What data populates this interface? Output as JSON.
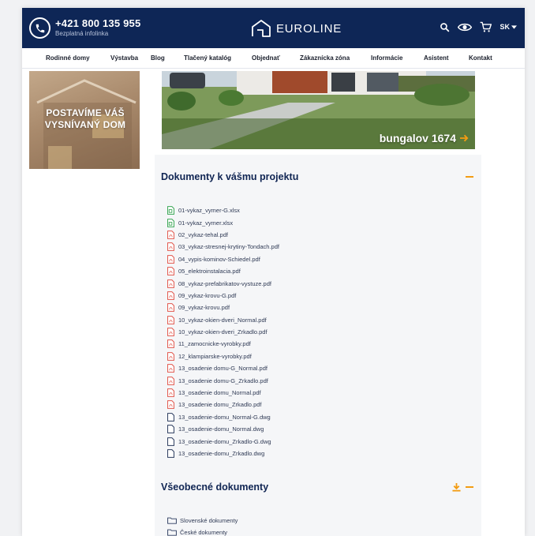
{
  "header": {
    "phone": "+421 800 135 955",
    "phone_caption": "Bezplatná infolinka",
    "logo_text": "EUROLINE",
    "language": "SK",
    "colors": {
      "bar": "#0e2656",
      "accent": "#f39c12"
    }
  },
  "nav": {
    "items": [
      "Rodinné domy",
      "Výstavba",
      "Blog",
      "Tlačený katalóg",
      "Objednať",
      "Zákaznícka zóna",
      "Informácie",
      "Asistent",
      "Kontakt"
    ]
  },
  "sidebar": {
    "banner_line1": "POSTAVÍME VÁŠ",
    "banner_line2": "VYSNÍVANÝ DOM"
  },
  "hero": {
    "label": "bungalov 1674",
    "arrow_icon": "arrow-right-icon"
  },
  "documents": {
    "title": "Dokumenty k vášmu projektu",
    "files": [
      {
        "name": "01-vykaz_vymer-G.xlsx",
        "type": "xlsx"
      },
      {
        "name": "01-vykaz_vymer.xlsx",
        "type": "xlsx"
      },
      {
        "name": "02_vykaz-tehal.pdf",
        "type": "pdf"
      },
      {
        "name": "03_vykaz-stresnej-krytiny-Tondach.pdf",
        "type": "pdf"
      },
      {
        "name": "04_vypis-kominov-Schiedel.pdf",
        "type": "pdf"
      },
      {
        "name": "05_elektroinstalacia.pdf",
        "type": "pdf"
      },
      {
        "name": "08_vykaz-prefabrikatov-vystuze.pdf",
        "type": "pdf"
      },
      {
        "name": "09_vykaz-krovu-G.pdf",
        "type": "pdf"
      },
      {
        "name": "09_vykaz-krovu.pdf",
        "type": "pdf"
      },
      {
        "name": "10_vykaz-okien-dveri_Normal.pdf",
        "type": "pdf"
      },
      {
        "name": "10_vykaz-okien-dveri_Zrkadlo.pdf",
        "type": "pdf"
      },
      {
        "name": "11_zamocnicke-vyrobky.pdf",
        "type": "pdf"
      },
      {
        "name": "12_klampiarske-vyrobky.pdf",
        "type": "pdf"
      },
      {
        "name": "13_osadenie domu-G_Normal.pdf",
        "type": "pdf"
      },
      {
        "name": "13_osadenie domu-G_Zrkadlo.pdf",
        "type": "pdf"
      },
      {
        "name": "13_osadenie domu_Normal.pdf",
        "type": "pdf"
      },
      {
        "name": "13_osadenie domu_Zrkadlo.pdf",
        "type": "pdf"
      },
      {
        "name": "13_osadenie-domu_Normal-G.dwg",
        "type": "dwg"
      },
      {
        "name": "13_osadenie-domu_Normal.dwg",
        "type": "dwg"
      },
      {
        "name": "13_osadenie-domu_Zrkadlo-G.dwg",
        "type": "dwg"
      },
      {
        "name": "13_osadenie-domu_Zrkadlo.dwg",
        "type": "dwg"
      }
    ]
  },
  "general": {
    "title": "Všeobecné dokumenty",
    "folders": [
      "Slovenské dokumenty",
      "České dokumenty"
    ]
  }
}
